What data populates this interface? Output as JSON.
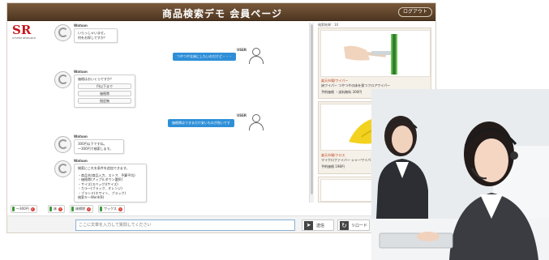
{
  "header": {
    "title": "商品検索デモ 会員ページ",
    "logout_label": "ログアウト"
  },
  "logo": {
    "text": "SR",
    "sub": "SYSTEM RESEARCH"
  },
  "chat": {
    "bot_name": "Watson",
    "user_name": "USER",
    "msg1": [
      "いらっしゃいませ。",
      "何をお探しですか？"
    ],
    "user_msg1": "つやつやな床にしたいのだけど・・・",
    "msg2_question": "価格はおいくらですか？",
    "msg2_options": [
      "円以下まで",
      "価格帯",
      "指定無"
    ],
    "user_msg2": "価格帯はできるだけ安いものが良いです",
    "msg3": [
      "300円以下ですね。",
      "～300円で検索します。"
    ],
    "msg4_intro": "検索にこれを条件を追加できます。",
    "msg4_items": [
      "・商品名(商品入力、ストア、予算平均)",
      "・価格帯(アップルダウン選択)",
      "・サイズ(スペック)(サイズ)",
      "・カラー(ブラック、オレンジ)",
      "・ブランド(ホワイト、ブラック)",
      "検索キーWord(B)"
    ]
  },
  "results": {
    "label": "検索結果：10",
    "items": [
      {
        "t1": "楽天市場/ワイパー",
        "t2": "床ワイパー つやつやの床を保つフロアワイパー",
        "t3": "予約価格 ・送料無料 300円"
      },
      {
        "t1": "楽天市場/クロス",
        "t2": "マイクロファイバー シャーワイパー・クロス2枚組",
        "t3": "予約価格 198円"
      },
      {
        "t1": "",
        "t2": "",
        "t3": ""
      }
    ]
  },
  "filters": [
    {
      "label": "～300円"
    },
    {
      "label": "床"
    },
    {
      "label": "床掃除"
    },
    {
      "label": "ワックス"
    }
  ],
  "input": {
    "placeholder": "ここに文章を入力して質問してください",
    "send_label": "送信",
    "reload_label": "リロード"
  },
  "colors": {
    "header": "#5a3f27",
    "user_bubble": "#2e8fd8",
    "logo_red": "#c8161d"
  }
}
